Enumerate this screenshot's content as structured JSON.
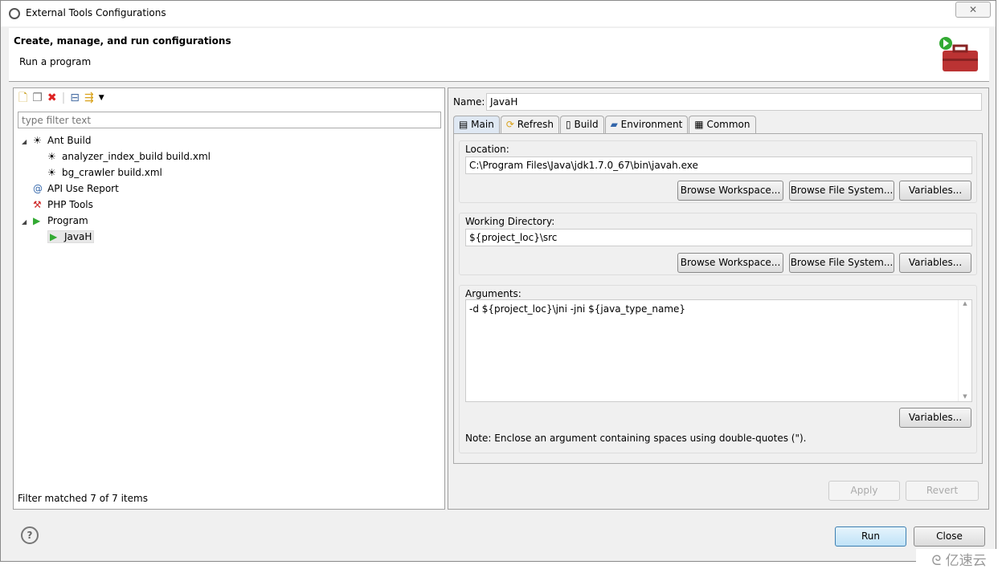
{
  "window": {
    "title": "External Tools Configurations"
  },
  "header": {
    "title": "Create, manage, and run configurations",
    "subtitle": "Run a program"
  },
  "left": {
    "filter_placeholder": "type filter text",
    "tree": [
      {
        "label": "Ant Build",
        "icon": "ant-icon",
        "level": 0,
        "expanded": true
      },
      {
        "label": "analyzer_index_build build.xml",
        "icon": "ant-icon",
        "level": 1
      },
      {
        "label": "bg_crawler build.xml",
        "icon": "ant-icon",
        "level": 1
      },
      {
        "label": "API Use Report",
        "icon": "api-report-icon",
        "level": 0
      },
      {
        "label": "PHP Tools",
        "icon": "php-tools-icon",
        "level": 0
      },
      {
        "label": "Program",
        "icon": "program-icon",
        "level": 0,
        "expanded": true
      },
      {
        "label": "JavaH",
        "icon": "program-icon",
        "level": 1,
        "selected": true
      }
    ],
    "status": "Filter matched 7 of 7 items"
  },
  "right": {
    "name_label": "Name:",
    "name_value": "JavaH",
    "tabs": [
      "Main",
      "Refresh",
      "Build",
      "Environment",
      "Common"
    ],
    "location": {
      "label": "Location:",
      "value": "C:\\Program Files\\Java\\jdk1.7.0_67\\bin\\javah.exe"
    },
    "workdir": {
      "label": "Working Directory:",
      "value": "${project_loc}\\src"
    },
    "arguments": {
      "label": "Arguments:",
      "value": "-d ${project_loc}\\jni -jni ${java_type_name}"
    },
    "browse_workspace": "Browse Workspace...",
    "browse_fs": "Browse File System...",
    "variables": "Variables...",
    "note": "Note: Enclose an argument containing spaces using double-quotes (\").",
    "apply": "Apply",
    "revert": "Revert"
  },
  "footer": {
    "run": "Run",
    "close": "Close",
    "help": "?"
  },
  "watermark": "亿速云"
}
